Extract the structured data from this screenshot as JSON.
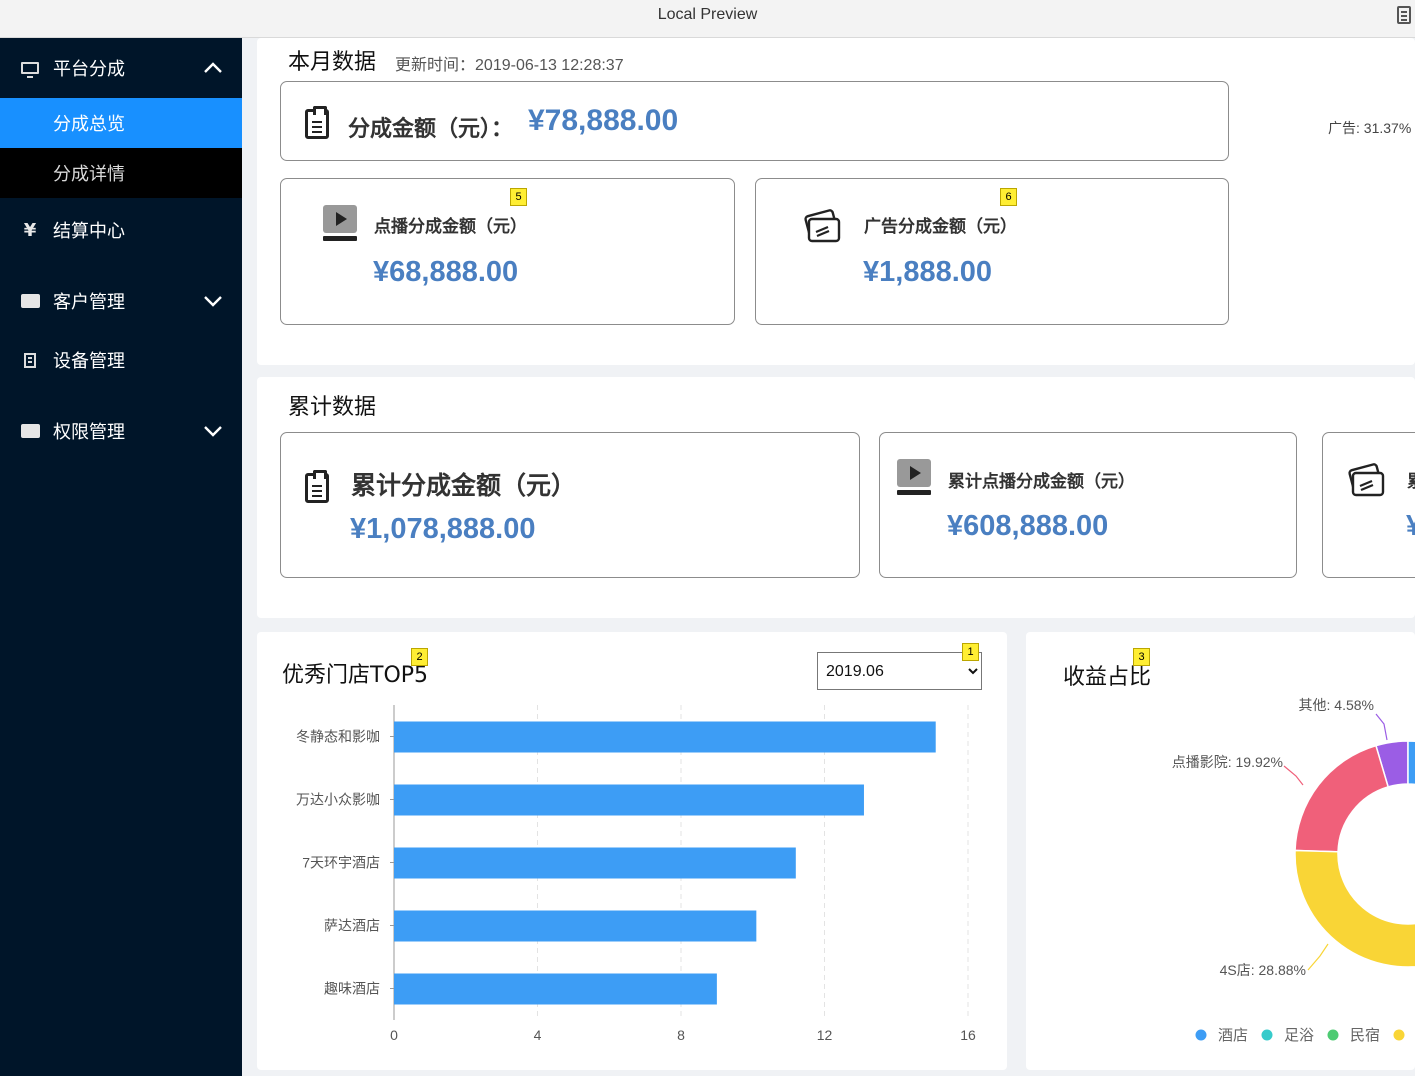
{
  "window": {
    "title": "Local Preview"
  },
  "sidebar": {
    "items": [
      {
        "label": "平台分成",
        "icon": "monitor-icon",
        "expanded": true
      },
      {
        "label": "分成总览",
        "selected": true
      },
      {
        "label": "分成详情"
      },
      {
        "label": "结算中心",
        "icon": "yen-icon"
      },
      {
        "label": "客户管理",
        "icon": "folder-icon"
      },
      {
        "label": "设备管理",
        "icon": "building-icon"
      },
      {
        "label": "权限管理",
        "icon": "folder-icon"
      }
    ],
    "yen_glyph": "¥"
  },
  "monthly": {
    "title": "本月数据",
    "updated_label": "更新时间：",
    "updated_time": "2019-06-13 12:28:37",
    "total_label": "分成金额（元）：",
    "total_value": "¥78,888.00",
    "vod_label": "点播分成金额（元）",
    "vod_value": "¥68,888.00",
    "ad_label": "广告分成金额（元）",
    "ad_value": "¥1,888.00",
    "side_pie_label": "广告: 31.37%"
  },
  "cumulative": {
    "title": "累计数据",
    "total_label": "累计分成金额（元）",
    "total_value": "¥1,078,888.00",
    "vod_label": "累计点播分成金额（元）",
    "vod_value": "¥608,888.00",
    "ad_label_partial": "累",
    "ad_value_partial": "¥"
  },
  "badges": {
    "b1": "1",
    "b2": "2",
    "b3": "3",
    "b5": "5",
    "b6": "6"
  },
  "top5": {
    "title": "优秀门店TOP5",
    "selected_month": "2019.06"
  },
  "chart_data": [
    {
      "type": "bar",
      "orientation": "horizontal",
      "title": "优秀门店TOP5",
      "categories": [
        "冬静态和影咖",
        "万达小众影咖",
        "7天环宇酒店",
        "萨达酒店",
        "趣味酒店"
      ],
      "values": [
        15.1,
        13.1,
        11.2,
        10.1,
        9.0
      ],
      "xlim": [
        0,
        16
      ],
      "xticks": [
        "0",
        "4",
        "8",
        "12",
        "16"
      ],
      "grid": true,
      "color": "#3d9df5"
    },
    {
      "type": "pie",
      "title": "收益占比",
      "donut": true,
      "slices": [
        {
          "label": "其他",
          "value": 4.58,
          "text": "其他: 4.58%",
          "color": "#9b5de5"
        },
        {
          "label": "点播影院",
          "value": 19.92,
          "text": "点播影院: 19.92%",
          "color": "#f0607a"
        },
        {
          "label": "4S店",
          "value": 28.88,
          "text": "4S店: 28.88%",
          "color": "#f9d536"
        }
      ],
      "legend": [
        {
          "label": "酒店",
          "color": "#3d9df5"
        },
        {
          "label": "足浴",
          "color": "#36cbcb"
        },
        {
          "label": "民宿",
          "color": "#4ecb73"
        },
        {
          "label": "",
          "color": "#f9d536"
        }
      ],
      "legend_position": "bottom"
    }
  ],
  "pie": {
    "title": "收益占比"
  }
}
